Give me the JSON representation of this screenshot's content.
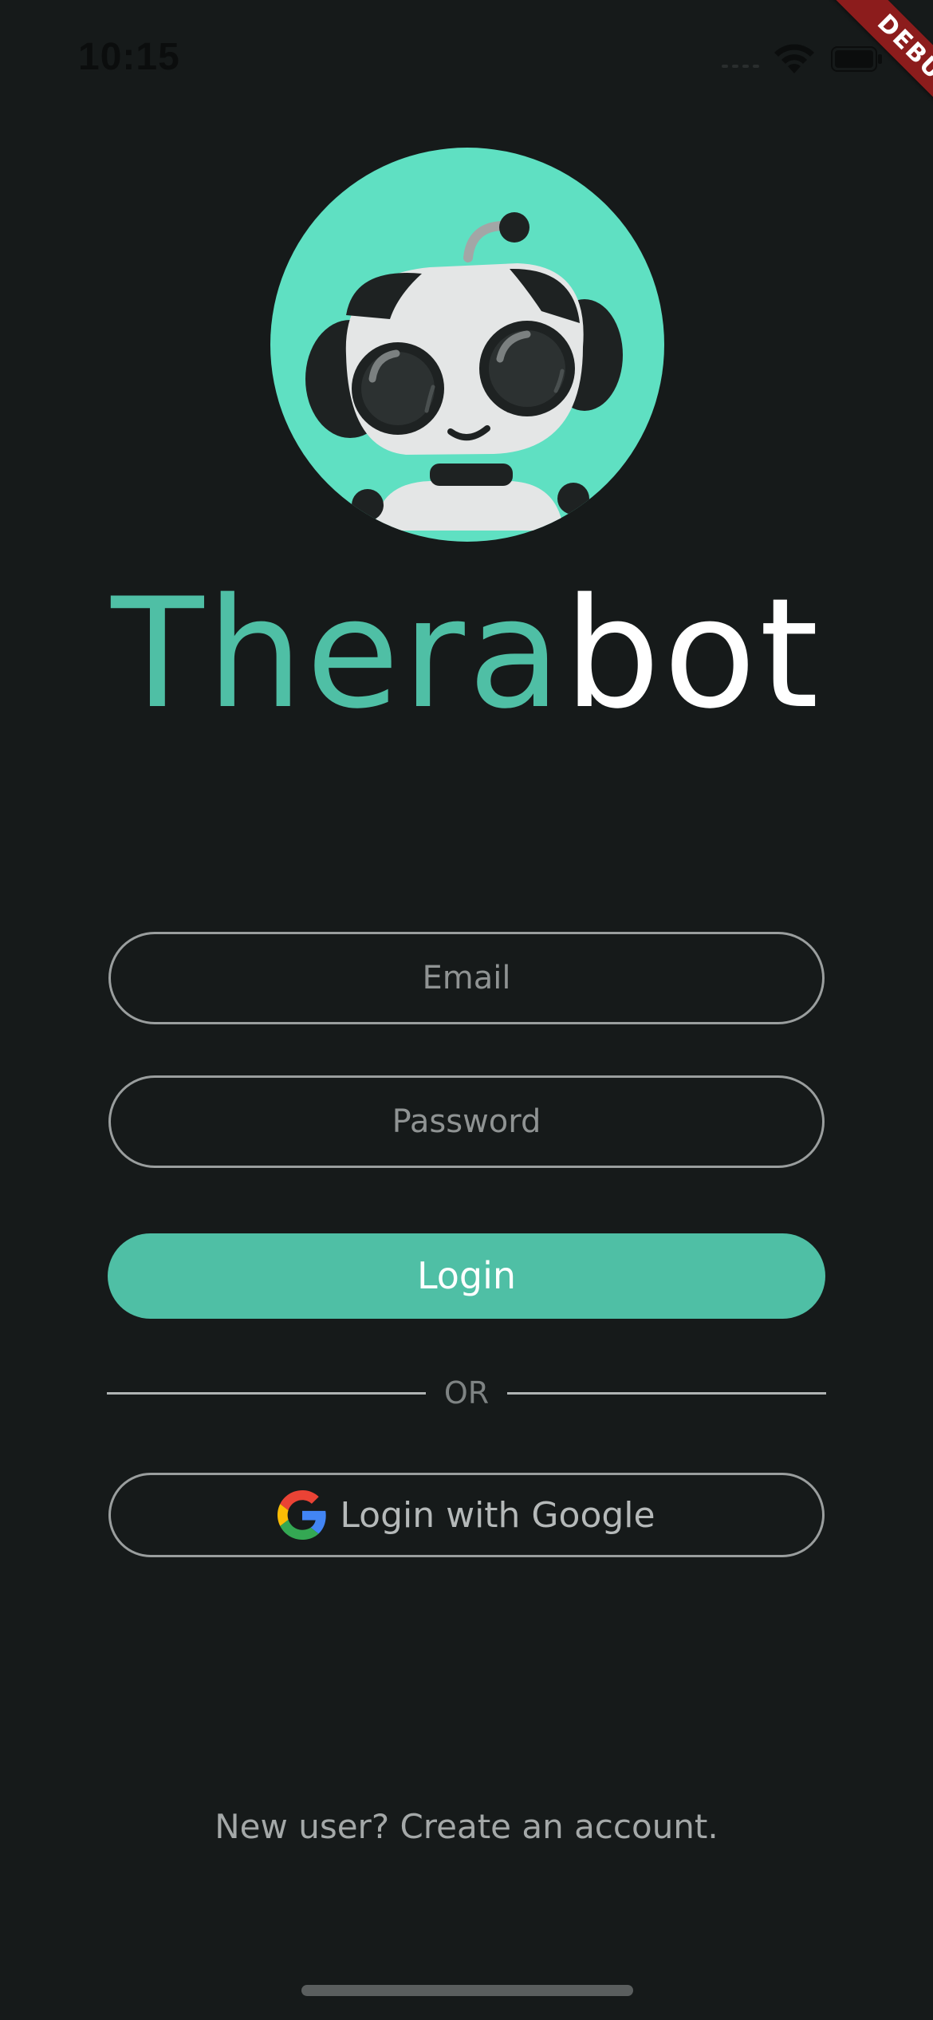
{
  "status_bar": {
    "time": "10:15"
  },
  "debug_banner": {
    "label": "DEBUG"
  },
  "brand": {
    "name_part1": "Thera",
    "name_part2": "bot"
  },
  "login_form": {
    "email_placeholder": "Email",
    "password_placeholder": "Password",
    "login_label": "Login",
    "divider_label": "OR",
    "google_label": "Login with Google"
  },
  "footer": {
    "signup_label": "New user? Create an account."
  },
  "colors": {
    "background": "#161a1a",
    "accent": "#4fbfa5",
    "avatar_background": "#5fe0c2",
    "debug_ribbon": "#8c1c1c"
  },
  "icons": {
    "wifi": "wifi-icon",
    "battery": "battery-icon",
    "signal": "signal-icon",
    "google": "google-icon",
    "avatar": "robot-avatar"
  }
}
